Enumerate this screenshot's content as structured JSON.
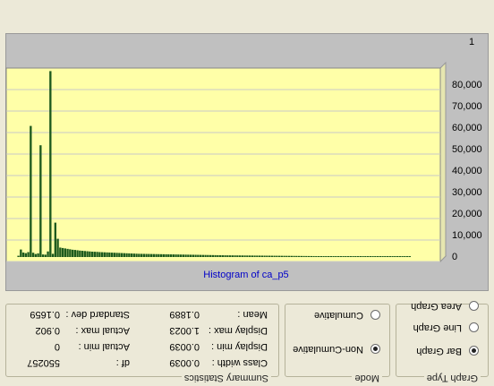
{
  "chart_data": {
    "type": "bar",
    "title": "Histogram of ca_p5",
    "y_tick_labels": [
      "0",
      "10,000",
      "20,000",
      "30,000",
      "40,000",
      "50,000",
      "60,000",
      "70,000",
      "80,000"
    ],
    "ylim": [
      0,
      90000
    ],
    "x_end_label": "1",
    "values": [
      600,
      3500,
      2100,
      1800,
      2300,
      61000,
      2000,
      1400,
      1700,
      52000,
      1200,
      1100,
      2600,
      86500,
      1500,
      16000,
      8500,
      4400,
      4200,
      4000,
      3800,
      3600,
      3400,
      3300,
      3150,
      3000,
      2900,
      2800,
      2700,
      2600,
      2500,
      2450,
      2400,
      2300,
      2250,
      2200,
      2150,
      2100,
      2050,
      2000,
      1950,
      1900,
      1850,
      1800,
      1750,
      1700,
      1650,
      1600,
      1550,
      1500,
      1480,
      1460,
      1440,
      1420,
      1400,
      1380,
      1360,
      1340,
      1320,
      1300,
      1280,
      1260,
      1240,
      1220,
      1200,
      1180,
      1160,
      1140,
      1120,
      1100,
      1080,
      1060,
      1040,
      1020,
      1000,
      980,
      960,
      940,
      920,
      900,
      880,
      860,
      840,
      820,
      800,
      790,
      780,
      770,
      760,
      750,
      740,
      730,
      720,
      710,
      700,
      690,
      680,
      670,
      660,
      650,
      640,
      630,
      620,
      610,
      600,
      590,
      580,
      570,
      560,
      550,
      540,
      530,
      520,
      510,
      500,
      490,
      480,
      470,
      460,
      450,
      440,
      430,
      420,
      410,
      400,
      390,
      380,
      370,
      360,
      350,
      340,
      330,
      320,
      310,
      300,
      290,
      280,
      270,
      260,
      250,
      240,
      230,
      220,
      210,
      200,
      190,
      180,
      170,
      160,
      150,
      140,
      130,
      120,
      110,
      100,
      90,
      80,
      70,
      60,
      50
    ]
  },
  "graph_type": {
    "title": "Graph Type",
    "options": [
      "Area Graph",
      "Line Graph",
      "Bar Graph"
    ],
    "selected": "Bar Graph"
  },
  "mode": {
    "title": "Mode",
    "options": [
      "Cumulative",
      "Non-Cumulative"
    ],
    "selected": "Non-Cumulative"
  },
  "summary": {
    "title": "Summary Statistics",
    "mean_label": "Mean :",
    "mean": "0.1889",
    "std_label": "Standard dev :",
    "std": "0.1659",
    "disp_max_label": "Display max :",
    "disp_max": "1.0023",
    "act_max_label": "Actual max :",
    "act_max": "0.902",
    "disp_min_label": "Display min :",
    "disp_min": "0.0039",
    "act_min_label": "Actual min :",
    "act_min": "0",
    "class_label": "Class width :",
    "class": "0.0039",
    "df_label": "df :",
    "df": "550257"
  },
  "colors": {
    "plot_bg": "#ffffa8",
    "bar": "#1d5a1d",
    "axis_text": "#000000",
    "title_text": "#0000c8",
    "grid": "#c8c8c8"
  }
}
